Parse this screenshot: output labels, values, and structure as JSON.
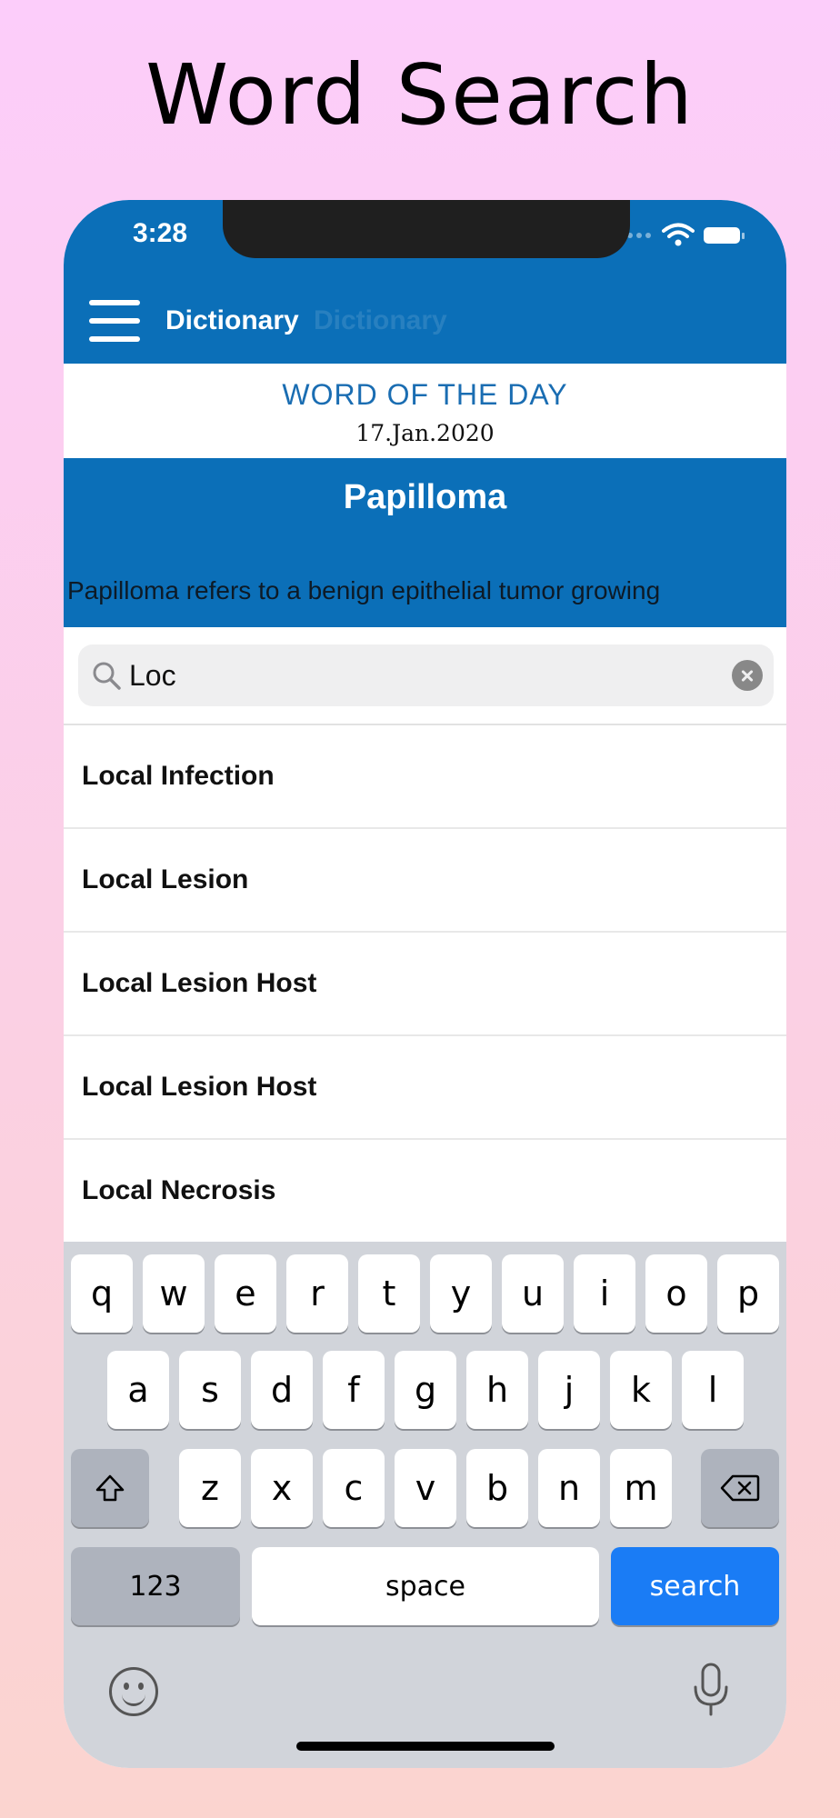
{
  "promo": {
    "title": "Word Search"
  },
  "status_bar": {
    "time": "3:28"
  },
  "header": {
    "title": "Dictionary",
    "title_ghost": "Dictionary"
  },
  "word_of_the_day": {
    "heading": "WORD OF THE DAY",
    "date": "17.Jan.2020",
    "word": "Papilloma",
    "definition": "Papilloma refers to a benign epithelial tumor growing"
  },
  "search": {
    "value": "Loc",
    "placeholder": ""
  },
  "results": [
    "Local Infection",
    "Local Lesion",
    "Local Lesion Host",
    "Local Lesion Host",
    "Local Necrosis"
  ],
  "keyboard": {
    "row1": [
      "q",
      "w",
      "e",
      "r",
      "t",
      "y",
      "u",
      "i",
      "o",
      "p"
    ],
    "row2": [
      "a",
      "s",
      "d",
      "f",
      "g",
      "h",
      "j",
      "k",
      "l"
    ],
    "row3": [
      "z",
      "x",
      "c",
      "v",
      "b",
      "n",
      "m"
    ],
    "num_label": "123",
    "space_label": "space",
    "search_label": "search",
    "shift_icon": "shift-icon",
    "delete_icon": "backspace-icon"
  },
  "colors": {
    "header_blue": "#0b6fb8",
    "heading_blue": "#1a6db2",
    "search_key_blue": "#1a7cf5"
  }
}
